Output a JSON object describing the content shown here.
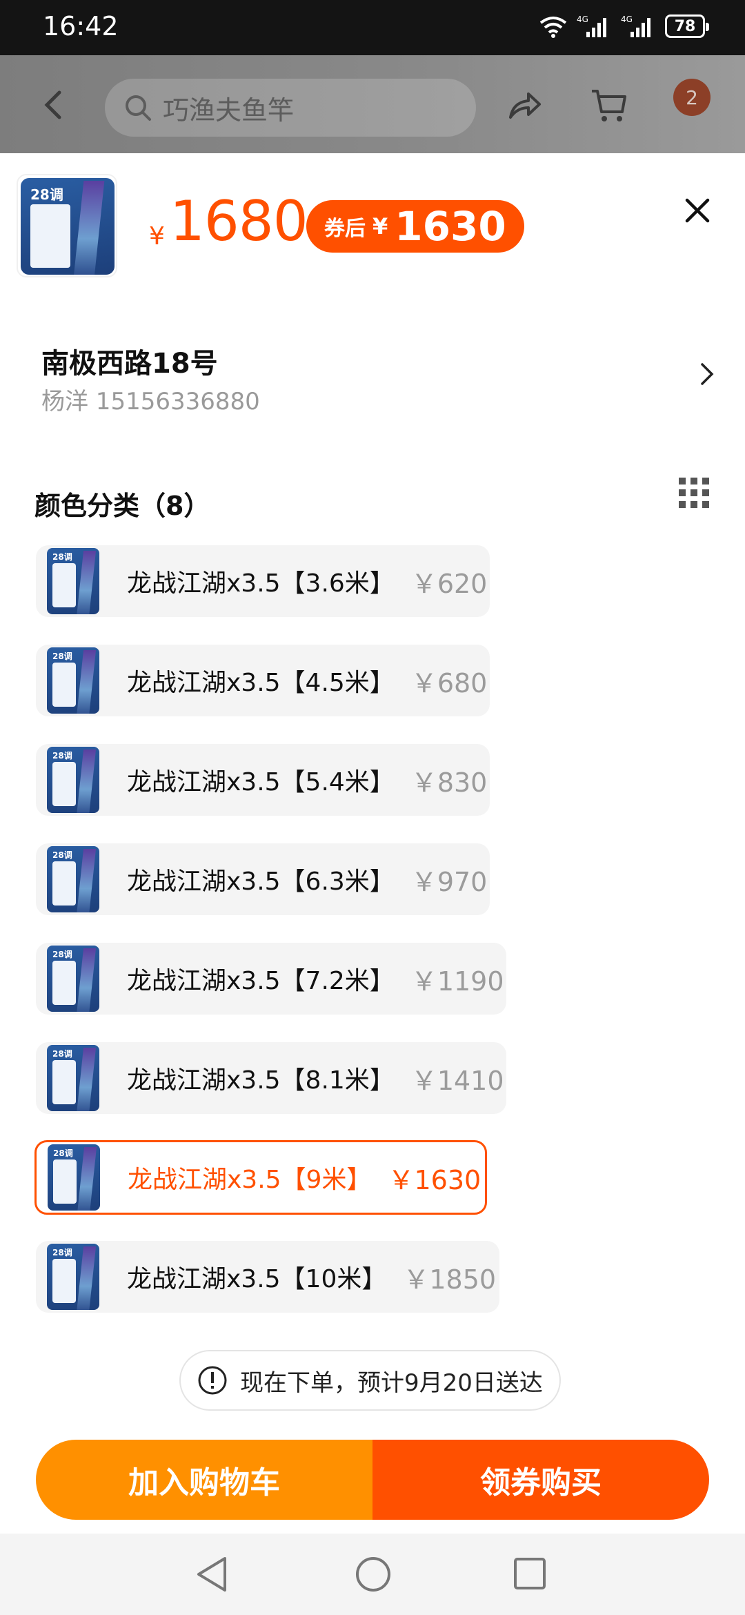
{
  "status_bar": {
    "time": "16:42",
    "network_1": "4G",
    "network_2": "4G",
    "battery": "78"
  },
  "header": {
    "search_text": "巧渔夫鱼竿",
    "cart_badge": "2"
  },
  "product": {
    "currency": "¥",
    "price": "1680",
    "coupon_label": "券后",
    "coupon_currency": "¥",
    "coupon_price": "1630"
  },
  "address": {
    "line1": "南极西路18号",
    "line2": "杨洋 15156336880"
  },
  "options": {
    "title": "颜色分类（8）",
    "items": [
      {
        "name": "龙战江湖x3.5【3.6米】",
        "price": "￥620",
        "selected": false
      },
      {
        "name": "龙战江湖x3.5【4.5米】",
        "price": "￥680",
        "selected": false
      },
      {
        "name": "龙战江湖x3.5【5.4米】",
        "price": "￥830",
        "selected": false
      },
      {
        "name": "龙战江湖x3.5【6.3米】",
        "price": "￥970",
        "selected": false
      },
      {
        "name": "龙战江湖x3.5【7.2米】",
        "price": "￥1190",
        "selected": false
      },
      {
        "name": "龙战江湖x3.5【8.1米】",
        "price": "￥1410",
        "selected": false
      },
      {
        "name": "龙战江湖x3.5【9米】",
        "price": "￥1630",
        "selected": true
      },
      {
        "name": "龙战江湖x3.5【10米】",
        "price": "￥1850",
        "selected": false
      }
    ]
  },
  "thumb_text": "28调",
  "delivery": {
    "text": "现在下单，预计9月20日送达"
  },
  "actions": {
    "add_to_cart": "加入购物车",
    "buy": "领券购买"
  },
  "colors": {
    "accent": "#ff5000",
    "cart_button": "#ff9000"
  }
}
